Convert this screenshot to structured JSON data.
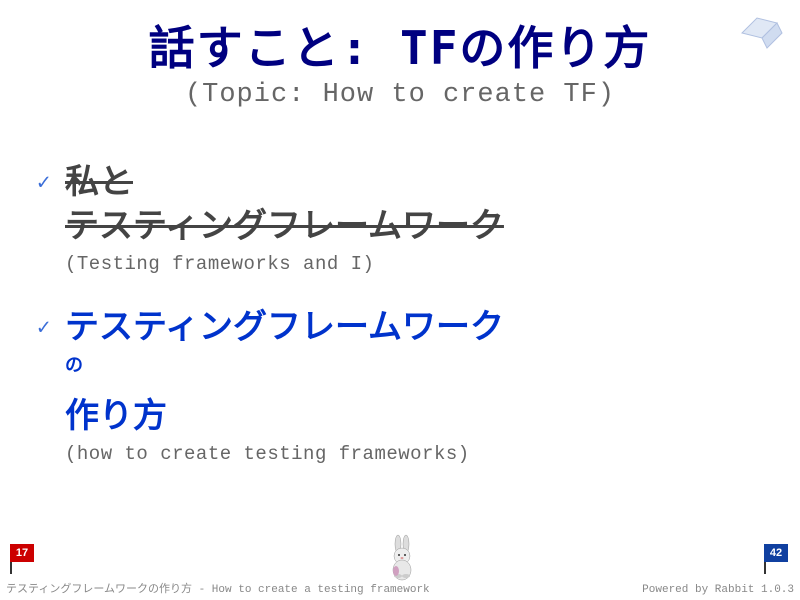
{
  "header": {
    "title": "話すこと: TFの作り方",
    "subtitle": "(Topic: How to create TF)"
  },
  "items": [
    {
      "line1": "私と",
      "line2": "テスティングフレームワーク",
      "sub": "(Testing frameworks and I)"
    },
    {
      "line1": "テスティングフレームワーク",
      "particle": "の",
      "line2": "作り方",
      "sub": "(how to create testing frameworks)"
    }
  ],
  "footer": {
    "left_flag": "17",
    "right_flag": "42",
    "left_text": "テスティングフレームワークの作り方 - How to create a testing framework",
    "right_text": "Powered by Rabbit 1.0.3"
  }
}
